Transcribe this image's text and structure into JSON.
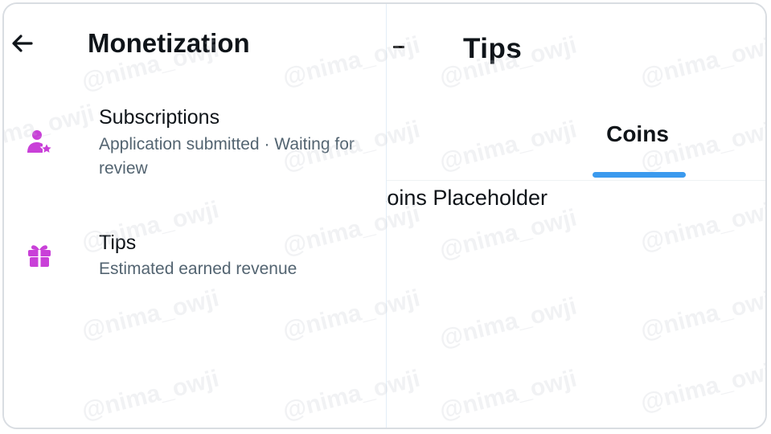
{
  "monetization": {
    "title": "Monetization",
    "items": [
      {
        "title": "Subscriptions",
        "subtitle": "Application submitted · Waiting for review",
        "icon": "person-star-icon"
      },
      {
        "title": "Tips",
        "subtitle": "Estimated earned revenue",
        "icon": "gift-icon"
      }
    ]
  },
  "tips_screen": {
    "title": "Tips",
    "tab_label": "Coins",
    "placeholder": "Coins Placeholder"
  },
  "watermark": "@nima_owji",
  "colors": {
    "accent_icon": "#c940d8",
    "tab_indicator": "#3b9aee",
    "primary_text": "#0f1419",
    "secondary_text": "#536471"
  }
}
